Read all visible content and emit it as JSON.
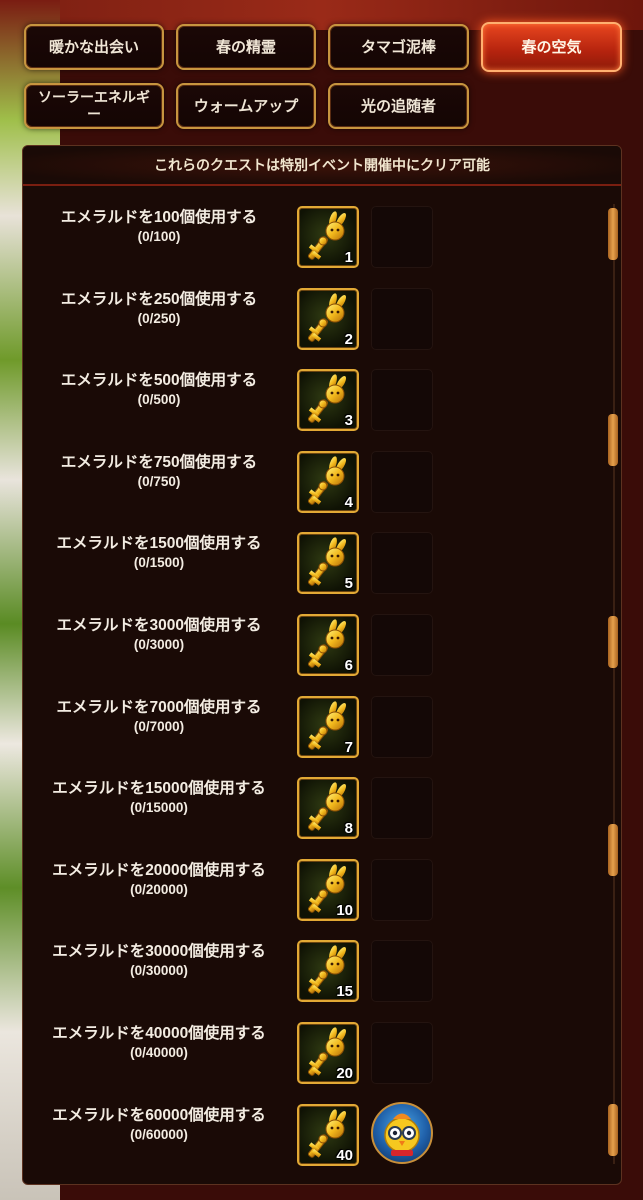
{
  "tabs": [
    {
      "label": "暖かな出会い",
      "active": false
    },
    {
      "label": "春の精霊",
      "active": false
    },
    {
      "label": "タマゴ泥棒",
      "active": false
    },
    {
      "label": "春の空気",
      "active": true
    },
    {
      "label": "ソーラーエネルギー",
      "active": false
    },
    {
      "label": "ウォームアップ",
      "active": false
    },
    {
      "label": "光の追随者",
      "active": false
    }
  ],
  "notice": "これらのクエストは特別イベント開催中にクリア可能",
  "quests": [
    {
      "title": "エメラルドを100個使用する",
      "progress": "(0/100)",
      "reward_icon": "golden-bunny-key-icon",
      "reward_count": "1"
    },
    {
      "title": "エメラルドを250個使用する",
      "progress": "(0/250)",
      "reward_icon": "golden-bunny-key-icon",
      "reward_count": "2"
    },
    {
      "title": "エメラルドを500個使用する",
      "progress": "(0/500)",
      "reward_icon": "golden-bunny-key-icon",
      "reward_count": "3"
    },
    {
      "title": "エメラルドを750個使用する",
      "progress": "(0/750)",
      "reward_icon": "golden-bunny-key-icon",
      "reward_count": "4"
    },
    {
      "title": "エメラルドを1500個使用する",
      "progress": "(0/1500)",
      "reward_icon": "golden-bunny-key-icon",
      "reward_count": "5"
    },
    {
      "title": "エメラルドを3000個使用する",
      "progress": "(0/3000)",
      "reward_icon": "golden-bunny-key-icon",
      "reward_count": "6"
    },
    {
      "title": "エメラルドを7000個使用する",
      "progress": "(0/7000)",
      "reward_icon": "golden-bunny-key-icon",
      "reward_count": "7"
    },
    {
      "title": "エメラルドを15000個使用する",
      "progress": "(0/15000)",
      "reward_icon": "golden-bunny-key-icon",
      "reward_count": "8"
    },
    {
      "title": "エメラルドを20000個使用する",
      "progress": "(0/20000)",
      "reward_icon": "golden-bunny-key-icon",
      "reward_count": "10"
    },
    {
      "title": "エメラルドを30000個使用する",
      "progress": "(0/30000)",
      "reward_icon": "golden-bunny-key-icon",
      "reward_count": "15"
    },
    {
      "title": "エメラルドを40000個使用する",
      "progress": "(0/40000)",
      "reward_icon": "golden-bunny-key-icon",
      "reward_count": "20"
    },
    {
      "title": "エメラルドを60000個使用する",
      "progress": "(0/60000)",
      "reward_icon": "golden-bunny-key-icon",
      "reward_count": "40",
      "bonus_icon": "chick-avatar-icon"
    }
  ],
  "colors": {
    "active_tab": "#d3351a",
    "tab_border": "#c7953f",
    "reward_border": "#e2a935",
    "scroll_thumb": "#e6a14d"
  }
}
